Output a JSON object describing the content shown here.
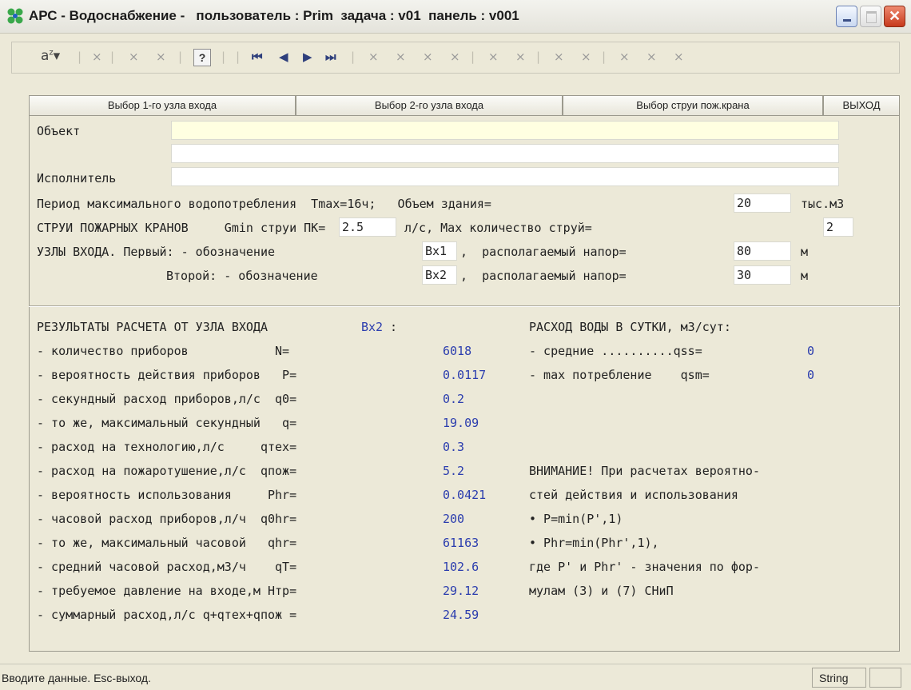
{
  "window": {
    "title": "АРС - Водоснабжение -   пользователь : Prim  задача : v01  панель : v001",
    "close_glyph": "✕"
  },
  "toolbar": {
    "sort_icon": "a-z-sort-icon",
    "help_label": "?",
    "disabled_glyph": "×",
    "nav_first": "⏮",
    "nav_prev": "◀",
    "nav_next": "▶",
    "nav_last": "⏭"
  },
  "tabs": [
    {
      "label": "Выбор 1-го узла входа"
    },
    {
      "label": "Выбор 2-го узла входа"
    },
    {
      "label": "Выбор струи пож.крана"
    },
    {
      "label": "ВЫХОД"
    }
  ],
  "form": {
    "object_label": "Объект",
    "object_value": "",
    "object_value2": "",
    "executor_label": "Исполнитель",
    "executor_value": "",
    "period_text": "Период максимального водопотребления  Tmax=16ч;   Объем здания=",
    "volume_value": "20",
    "volume_unit": "тыс.м3",
    "jets_text": "СТРУИ ПОЖАРНЫХ КРАНОВ     Gmin струи ПК=",
    "gmin_value": "2.5",
    "jets_mid": "л/с, Max количество струй=",
    "max_jets_value": "2",
    "nodes_text1": "УЗЛЫ ВХОДА. Первый: - обозначение",
    "node1_name": "Вх1",
    "nodes_mid1": ",  располагаемый напор=",
    "node1_head": "80",
    "unit_m1": "м",
    "nodes_text2": "Второй: - обозначение",
    "node2_name": "Вх2",
    "nodes_mid2": ",  располагаемый напор=",
    "node2_head": "30",
    "unit_m2": "м"
  },
  "results": {
    "heading": "РЕЗУЛЬТАТЫ РАСЧЕТА ОТ УЗЛА ВХОДА",
    "node": "Вх2",
    "colon": ":",
    "daily_heading": "РАСХОД ВОДЫ В СУТКИ, м3/сут:",
    "rows": [
      {
        "label": "- количество приборов            N=",
        "value": "6018"
      },
      {
        "label": "- вероятность действия приборов   P=",
        "value": "0.0117"
      },
      {
        "label": "- секундный расход приборов,л/с  q0=",
        "value": "0.2"
      },
      {
        "label": "- то же, максимальный секундный   q=",
        "value": "19.09"
      },
      {
        "label": "- расход на технологию,л/с     qтех=",
        "value": "0.3"
      },
      {
        "label": "- расход на пожаротушение,л/с  qпож=",
        "value": "5.2"
      },
      {
        "label": "- вероятность использования     Phr=",
        "value": "0.0421"
      },
      {
        "label": "- часовой расход приборов,л/ч  q0hr=",
        "value": "200"
      },
      {
        "label": "- то же, максимальный часовой   qhr=",
        "value": "61163"
      },
      {
        "label": "- средний часовой расход,м3/ч    qT=",
        "value": "102.6"
      },
      {
        "label": "- требуемое давление на входе,м Нтр=",
        "value": "29.12"
      },
      {
        "label": "- суммарный расход,л/с q+qтех+qпож =",
        "value": "24.59"
      }
    ],
    "daily_rows": [
      {
        "label": "- средние ..........qss=",
        "value": "0"
      },
      {
        "label": "- max потребление    qsm=",
        "value": "0"
      }
    ],
    "notes": [
      "ВНИМАНИЕ! При расчетах вероятно-",
      "стей действия и использования",
      "• P=min(P',1)",
      "• Phr=min(Phr',1),",
      "где P' и Phr' - значения по фор-",
      "мулам (3) и (7) СНиП"
    ]
  },
  "status": {
    "message": "Вводите данные. Esc-выход.",
    "mode": "String"
  }
}
